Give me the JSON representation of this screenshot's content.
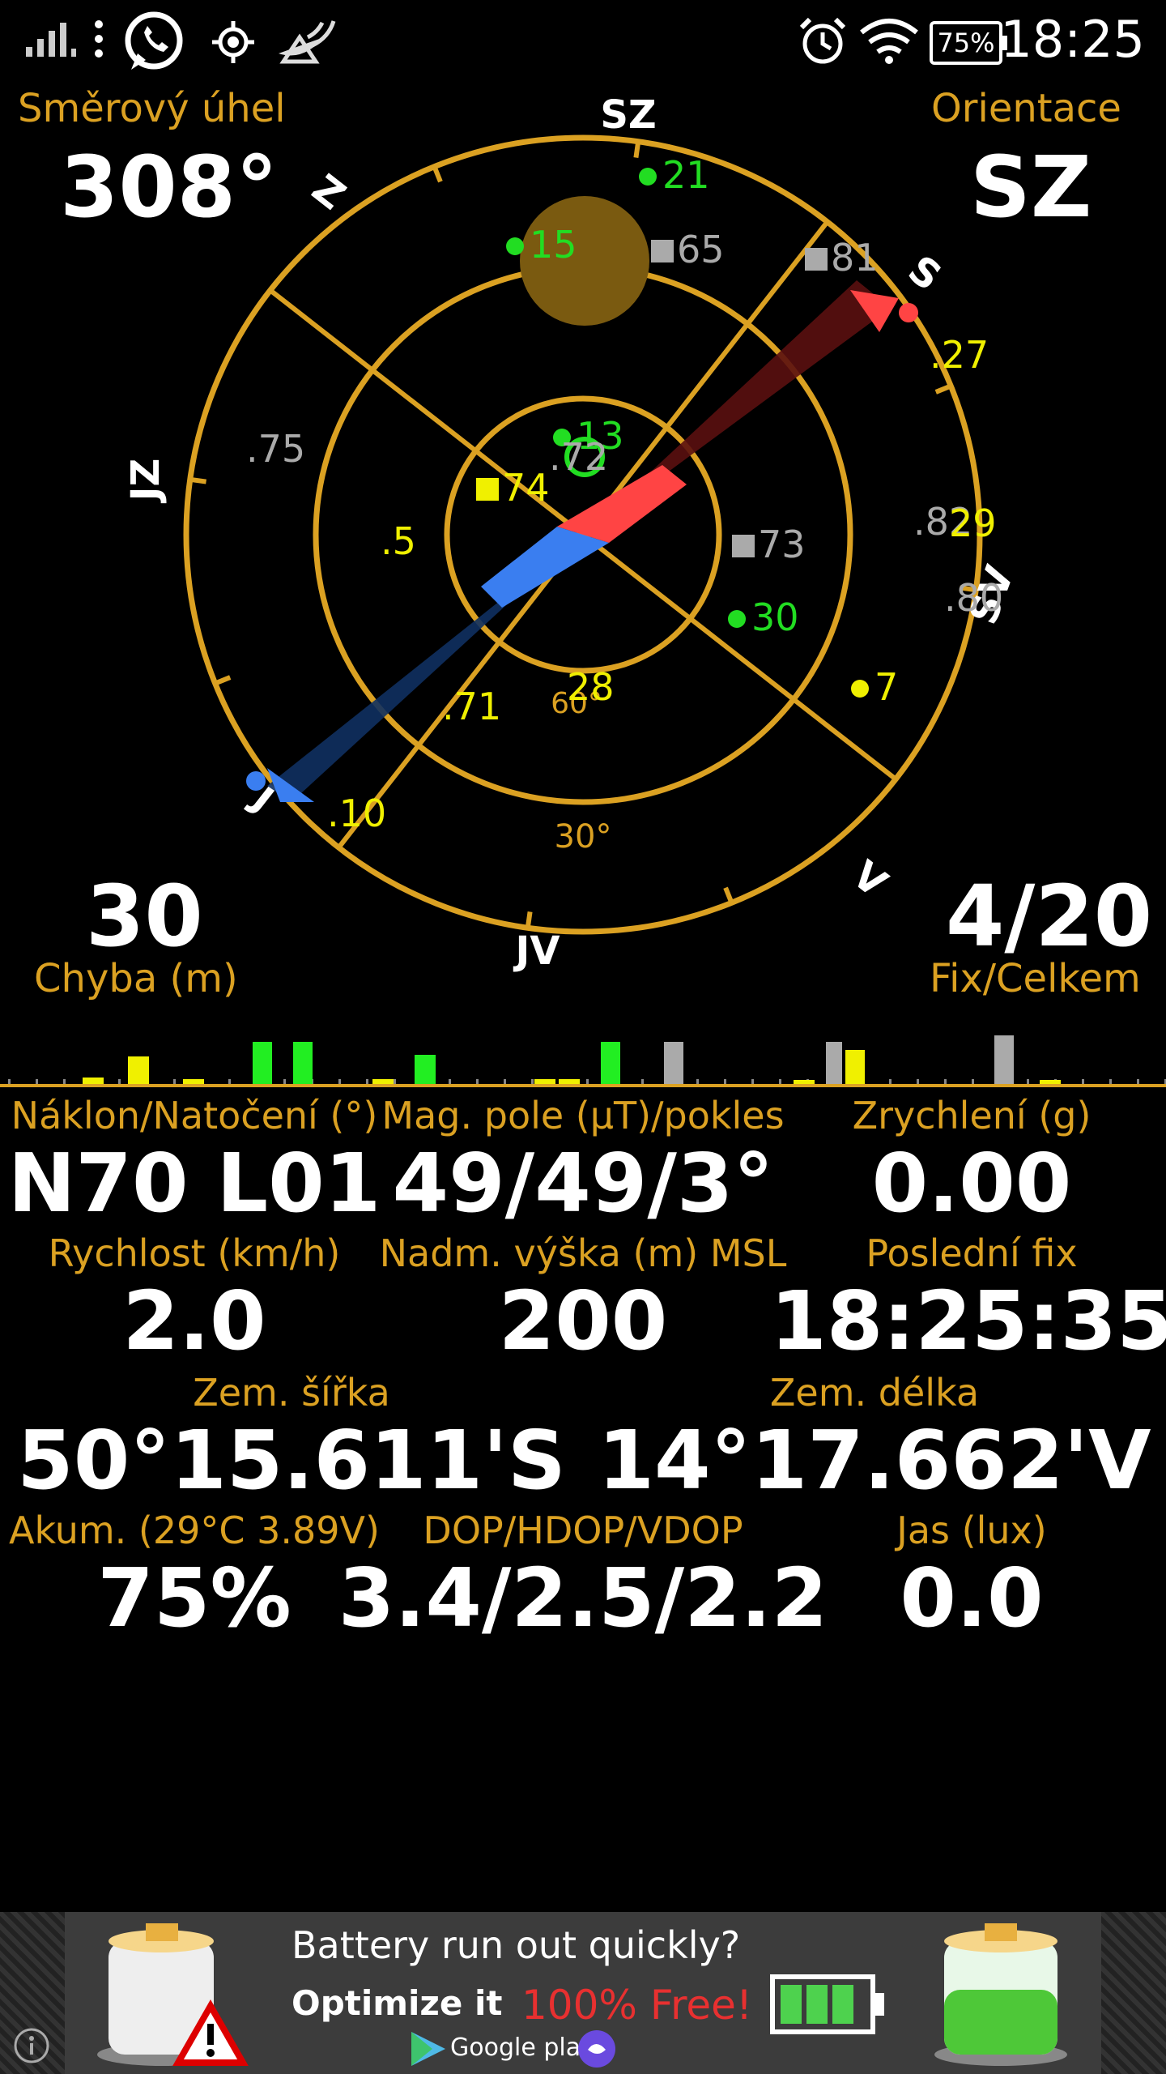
{
  "status_bar": {
    "time": "18:25",
    "battery": "75%",
    "icons": [
      "signal-icon",
      "whatsapp-icon",
      "gps-icon",
      "satellite-dish-icon",
      "alarm-icon",
      "wifi-icon",
      "battery-icon"
    ]
  },
  "heading": {
    "label": "Směrový úhel",
    "value": "308°"
  },
  "orientation": {
    "label": "Orientace",
    "value": "SZ"
  },
  "error": {
    "value": "30",
    "label": "Chyba (m)"
  },
  "fix": {
    "value": "4/20",
    "label": "Fix/Celkem"
  },
  "radar": {
    "compass_labels": [
      "SZ",
      "S",
      "SV",
      "V",
      "JV",
      "J",
      "JZ",
      "Z"
    ],
    "ring_labels": [
      "30°",
      "60°"
    ],
    "heading_deg": 308,
    "satellites": [
      {
        "id": "21",
        "color": "#22dd22",
        "shape": "dot"
      },
      {
        "id": "15",
        "color": "#22dd22",
        "shape": "dot"
      },
      {
        "id": "65",
        "color": "#aaaaaa",
        "shape": "square"
      },
      {
        "id": "81",
        "color": "#aaaaaa",
        "shape": "square"
      },
      {
        "id": ".27",
        "color": "#f0f000",
        "shape": "none"
      },
      {
        "id": "13",
        "color": "#22dd22",
        "shape": "dot"
      },
      {
        "id": ".72",
        "color": "#aaaaaa",
        "shape": "none"
      },
      {
        "id": "74",
        "color": "#f0f000",
        "shape": "square"
      },
      {
        "id": ".75",
        "color": "#aaaaaa",
        "shape": "none"
      },
      {
        "id": ".5",
        "color": "#f0f000",
        "shape": "none"
      },
      {
        "id": "73",
        "color": "#aaaaaa",
        "shape": "square"
      },
      {
        "id": ".82",
        "color": "#aaaaaa",
        "shape": "none"
      },
      {
        "id": "29",
        "color": "#f0f000",
        "shape": "none"
      },
      {
        "id": ".80",
        "color": "#aaaaaa",
        "shape": "none"
      },
      {
        "id": "30",
        "color": "#22dd22",
        "shape": "dot"
      },
      {
        "id": "7",
        "color": "#f0f000",
        "shape": "dot"
      },
      {
        "id": "28",
        "color": "#f0f000",
        "shape": "none"
      },
      {
        "id": ".71",
        "color": "#f0f000",
        "shape": "none"
      },
      {
        "id": ".10",
        "color": "#f0f000",
        "shape": "none"
      }
    ]
  },
  "signal_bars": [
    {
      "color": "#f0f000",
      "value": 0.15
    },
    {
      "color": "#f0f000",
      "value": 0.65
    },
    {
      "color": "#f0f000",
      "value": 0.12
    },
    {
      "color": "#22ee22",
      "value": 1.0
    },
    {
      "color": "#22ee22",
      "value": 1.0
    },
    {
      "color": "#f0f000",
      "value": 0.12
    },
    {
      "color": "#22ee22",
      "value": 0.7
    },
    {
      "color": "#f0f000",
      "value": 0.12
    },
    {
      "color": "#f0f000",
      "value": 0.12
    },
    {
      "color": "#22ee22",
      "value": 1.0
    },
    {
      "color": "#aaaaaa",
      "value": 1.0
    },
    {
      "color": "#f0f000",
      "value": 0.1
    },
    {
      "color": "#aaaaaa",
      "value": 1.0
    },
    {
      "color": "#f0f000",
      "value": 0.8
    },
    {
      "color": "#aaaaaa",
      "value": 1.15
    },
    {
      "color": "#f0f000",
      "value": 0.1
    }
  ],
  "fields": [
    {
      "label": "Náklon/Natočení (°)",
      "value": "N70 L01"
    },
    {
      "label": "Mag. pole (µT)/pokles",
      "value": "49/49/3°"
    },
    {
      "label": "Zrychlení (g)",
      "value": "0.00"
    },
    {
      "label": "Rychlost (km/h)",
      "value": "2.0"
    },
    {
      "label": "Nadm. výška (m) MSL",
      "value": "200"
    },
    {
      "label": "Poslední fix",
      "value": "18:25:35"
    },
    {
      "label": "Zem. šířka",
      "value": "50°15.611'S"
    },
    {
      "label": "Zem. délka",
      "value": "14°17.662'V"
    },
    {
      "label": "Akum. (29°C 3.89V)",
      "value": "75%"
    },
    {
      "label": "DOP/HDOP/VDOP",
      "value": "3.4/2.5/2.2"
    },
    {
      "label": "Jas (lux)",
      "value": "0.0"
    }
  ],
  "ad": {
    "line1": "Battery run out quickly?",
    "line2": "Optimize it",
    "line3": "100% Free!",
    "store": "Google play"
  }
}
